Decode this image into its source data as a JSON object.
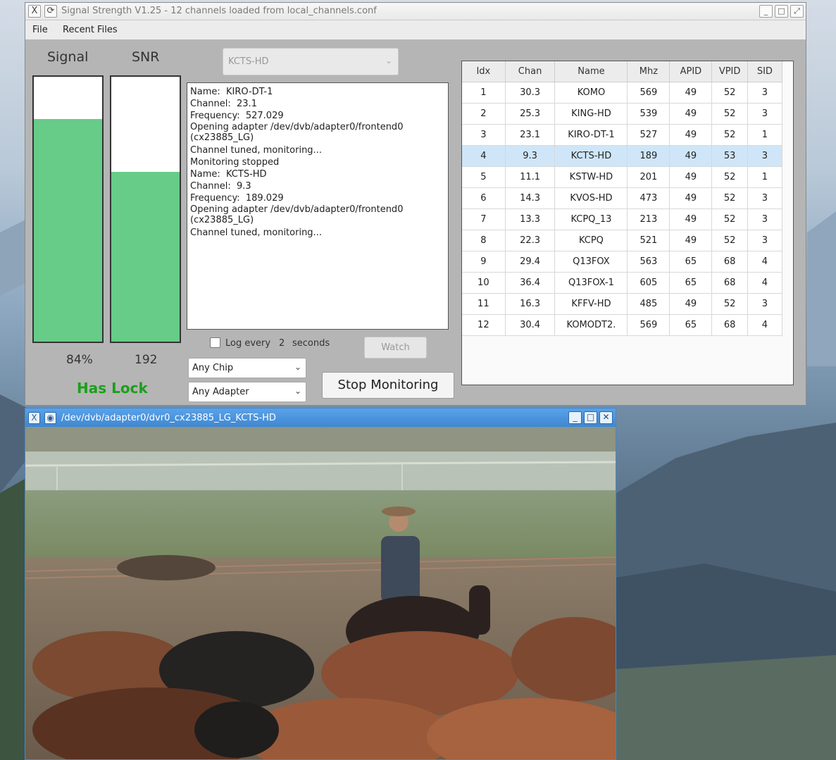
{
  "main_window": {
    "title": "Signal Strength V1.25 - 12 channels loaded from local_channels.conf",
    "menu": [
      "File",
      "Recent Files"
    ]
  },
  "meters": {
    "signal": {
      "label": "Signal",
      "value_text": "84%",
      "fill_fraction": 0.84
    },
    "snr": {
      "label": "SNR",
      "value_text": "192",
      "fill_fraction": 0.64
    }
  },
  "lock_status": "Has Lock",
  "channel_select": {
    "value": "KCTS-HD"
  },
  "log": [
    "Name:  KIRO-DT-1",
    "Channel:  23.1",
    "Frequency:  527.029",
    "Opening adapter /dev/dvb/adapter0/frontend0\n(cx23885_LG)",
    "Channel tuned, monitoring...",
    "Monitoring stopped",
    "Name:  KCTS-HD",
    "Channel:  9.3",
    "Frequency:  189.029",
    "Opening adapter /dev/dvb/adapter0/frontend0\n(cx23885_LG)",
    "Channel tuned, monitoring..."
  ],
  "log_every": {
    "label_before": "Log every",
    "interval": "2",
    "label_after": "seconds",
    "checked": false
  },
  "watch_button": "Watch",
  "chip_select": "Any Chip",
  "adapter_select": "Any Adapter",
  "stop_button": "Stop Monitoring",
  "table": {
    "columns": [
      "Idx",
      "Chan",
      "Name",
      "Mhz",
      "APID",
      "VPID",
      "SID"
    ],
    "selected_index": 3,
    "rows": [
      [
        "1",
        "30.3",
        "KOMO",
        "569",
        "49",
        "52",
        "3"
      ],
      [
        "2",
        "25.3",
        "KING-HD",
        "539",
        "49",
        "52",
        "3"
      ],
      [
        "3",
        "23.1",
        "KIRO-DT-1",
        "527",
        "49",
        "52",
        "1"
      ],
      [
        "4",
        "9.3",
        "KCTS-HD",
        "189",
        "49",
        "53",
        "3"
      ],
      [
        "5",
        "11.1",
        "KSTW-HD",
        "201",
        "49",
        "52",
        "1"
      ],
      [
        "6",
        "14.3",
        "KVOS-HD",
        "473",
        "49",
        "52",
        "3"
      ],
      [
        "7",
        "13.3",
        "KCPQ_13",
        "213",
        "49",
        "52",
        "3"
      ],
      [
        "8",
        "22.3",
        "KCPQ",
        "521",
        "49",
        "52",
        "3"
      ],
      [
        "9",
        "29.4",
        "Q13FOX",
        "563",
        "65",
        "68",
        "4"
      ],
      [
        "10",
        "36.4",
        "Q13FOX-1",
        "605",
        "65",
        "68",
        "4"
      ],
      [
        "11",
        "16.3",
        "KFFV-HD",
        "485",
        "49",
        "52",
        "3"
      ],
      [
        "12",
        "30.4",
        "KOMODT2.",
        "569",
        "65",
        "68",
        "4"
      ]
    ]
  },
  "video_window": {
    "title": "/dev/dvb/adapter0/dvr0_cx23885_LG_KCTS-HD"
  },
  "colors": {
    "meter_fill": "#66cc88",
    "lock_text": "#1aa01a",
    "selected_row": "#cfe6f8",
    "video_titlebar": "#4a94df"
  }
}
